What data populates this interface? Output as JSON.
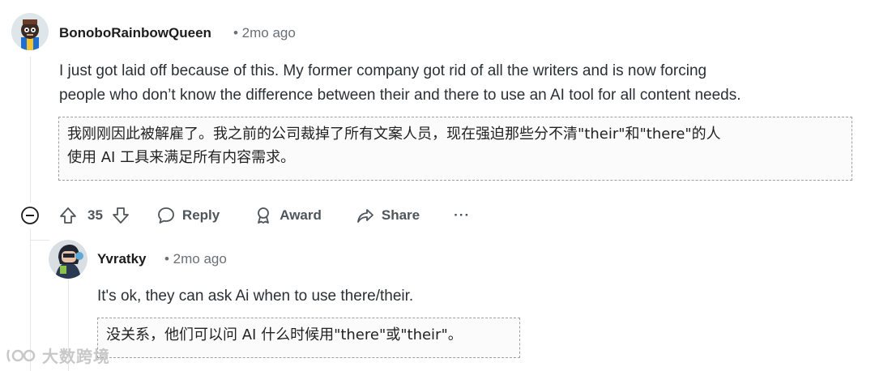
{
  "comment1": {
    "author": "BonoboRainbowQueen",
    "time": "• 2mo ago",
    "body_line1": "I just got laid off because of this. My former company got rid of all the writers and is now forcing",
    "body_line2": "people who don’t know the difference between their and there to use an AI tool for all content needs.",
    "translation_line1": "我刚刚因此被解雇了。我之前的公司裁掉了所有文案人员，现在强迫那些分不清\"their\"和\"there\"的人",
    "translation_line2": "使用 AI 工具来满足所有内容需求。",
    "votes": "35",
    "reply_label": "Reply",
    "award_label": "Award",
    "share_label": "Share",
    "more_label": "···"
  },
  "comment2": {
    "author": "Yvratky",
    "time": "• 2mo ago",
    "body": "It's ok, they can ask Ai when to use there/their.",
    "translation": "没关系，他们可以问 AI 什么时候用\"there\"或\"their\"。"
  },
  "watermark": {
    "text": "大数跨境"
  },
  "colors": {
    "text": "#2a3033",
    "meta": "#6a7075",
    "border": "#9aa0a6"
  },
  "icons": [
    "collapse-icon",
    "upvote-icon",
    "downvote-icon",
    "reply-icon",
    "award-icon",
    "share-icon",
    "more-icon"
  ]
}
